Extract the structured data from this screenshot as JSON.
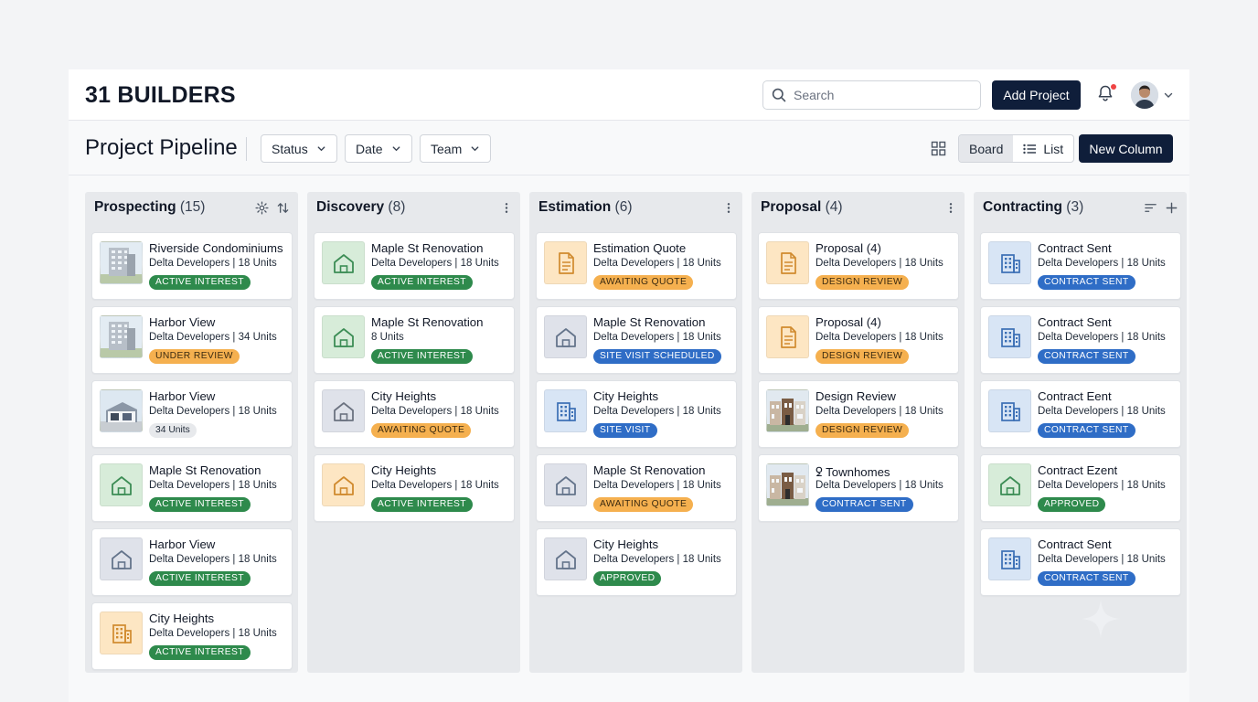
{
  "brand": "31 BUILDERS",
  "search": {
    "placeholder": "Search"
  },
  "header": {
    "add_project_label": "Add Project"
  },
  "toolbar": {
    "title": "Project Pipeline",
    "filters": [
      "Status",
      "Date",
      "Team"
    ],
    "views": {
      "board": "Board",
      "list": "List",
      "active": "Board"
    },
    "new_column_label": "New Column"
  },
  "colors": {
    "brand_dark": "#0f1e3a",
    "status_green": "#2e8a4c",
    "status_orange": "#f5b04f",
    "status_blue": "#2f6dc6",
    "notification_red": "#ef4444"
  },
  "columns": [
    {
      "name": "Prospecting",
      "count": "(15)",
      "cards": [
        {
          "title": "Riverside Condominiums",
          "sub": "Delta Developers | 18 Units",
          "status": "ACTIVE INTEREST",
          "icon": "apartment-photo-icon"
        },
        {
          "title": "Harbor View",
          "sub": "Delta Developers | 34 Units",
          "status": "UNDER REVIEW",
          "icon": "apartment-photo-icon"
        },
        {
          "title": "Harbor View",
          "sub": "Delta Developers | 18 Units",
          "status": "34 Units",
          "icon": "house-photo-icon"
        },
        {
          "title": "Maple St Renovation",
          "sub": "Delta Developers | 18 Units",
          "status": "ACTIVE INTEREST",
          "icon": "house-icon"
        },
        {
          "title": "Harbor View",
          "sub": "Delta Developers | 18 Units",
          "status": "ACTIVE INTEREST",
          "icon": "house-icon"
        },
        {
          "title": "City Heights",
          "sub": "Delta Developers | 18 Units",
          "status": "ACTIVE INTEREST",
          "icon": "building-icon"
        }
      ]
    },
    {
      "name": "Discovery",
      "count": "(8)",
      "cards": [
        {
          "title": "Maple St Renovation",
          "sub": "Delta Developers | 18 Units",
          "status": "ACTIVE INTEREST",
          "icon": "house-icon"
        },
        {
          "title": "Maple St Renovation",
          "sub": "8 Units",
          "status": "ACTIVE INTEREST",
          "icon": "house-icon"
        },
        {
          "title": "City Heights",
          "sub": "Delta Developers | 18 Units",
          "status": "AWAITING QUOTE",
          "icon": "house-icon"
        },
        {
          "title": "City Heights",
          "sub": "Delta Developers | 18 Units",
          "status": "ACTIVE INTEREST",
          "icon": "house-icon"
        }
      ]
    },
    {
      "name": "Estimation",
      "count": "(6)",
      "cards": [
        {
          "title": "Estimation Quote",
          "sub": "Delta Developers | 18 Units",
          "status": "AWAITING QUOTE",
          "icon": "document-icon"
        },
        {
          "title": "Maple St Renovation",
          "sub": "Delta Developers | 18 Units",
          "status": "SITE VISIT SCHEDULED",
          "icon": "house-icon"
        },
        {
          "title": "City Heights",
          "sub": "Delta Developers | 18 Units",
          "status": "SITE VISIT",
          "icon": "building-icon"
        },
        {
          "title": "Maple St Renovation",
          "sub": "Delta Developers | 18 Units",
          "status": "AWAITING QUOTE",
          "icon": "house-icon"
        },
        {
          "title": "City Heights",
          "sub": "Delta Developers | 18 Units",
          "status": "APPROVED",
          "icon": "house-icon"
        }
      ]
    },
    {
      "name": "Proposal",
      "count": "(4)",
      "cards": [
        {
          "title": "Proposal (4)",
          "sub": "Delta Developers | 18 Units",
          "status": "DESIGN REVIEW",
          "icon": "document-icon"
        },
        {
          "title": "Proposal (4)",
          "sub": "Delta Developers | 18 Units",
          "status": "DESIGN REVIEW",
          "icon": "document-icon"
        },
        {
          "title": "Design Review",
          "sub": "Delta Developers | 18 Units",
          "status": "DESIGN REVIEW",
          "icon": "townhouse-photo-icon"
        },
        {
          "title": "ꝿ Townhomes",
          "sub": "Delta Developers | 18 Units",
          "status": "CONTRACT SENT",
          "icon": "townhouse-photo-icon"
        }
      ]
    },
    {
      "name": "Contracting",
      "count": "(3)",
      "cards": [
        {
          "title": "Contract Sent",
          "sub": "Delta Developers | 18 Units",
          "status": "CONTRACT SENT",
          "icon": "building-icon"
        },
        {
          "title": "Contract Sent",
          "sub": "Delta Developers | 18 Units",
          "status": "CONTRACT SENT",
          "icon": "building-icon"
        },
        {
          "title": "Contract Eent",
          "sub": "Delta Developers | 18 Units",
          "status": "CONTRACT SENT",
          "icon": "building-icon"
        },
        {
          "title": "Contract Ezent",
          "sub": "Delta Developers | 18 Units",
          "status": "APPROVED",
          "icon": "house-icon"
        },
        {
          "title": "Contract Sent",
          "sub": "Delta Developers | 18 Units",
          "status": "CONTRACT SENT",
          "icon": "building-icon"
        }
      ]
    }
  ]
}
